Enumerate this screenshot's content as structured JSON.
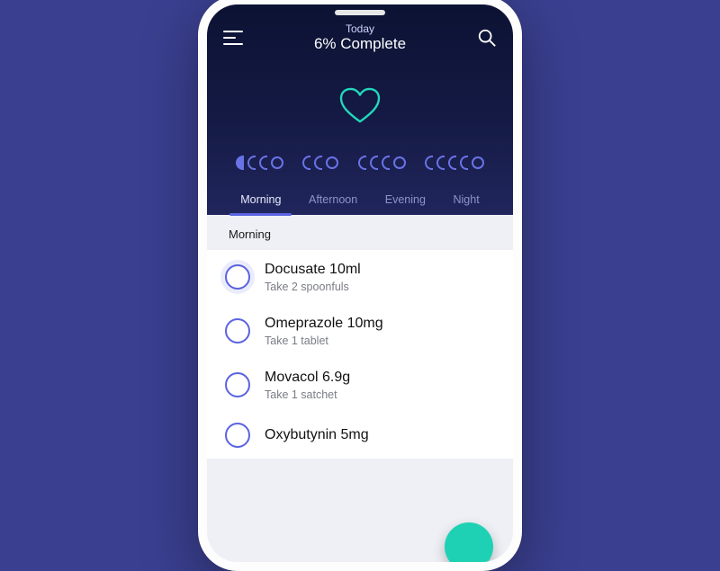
{
  "header": {
    "subtitle": "Today",
    "title": "6% Complete"
  },
  "progress": {
    "groups": [
      {
        "filled": 1,
        "pills": 3,
        "circles": 1
      },
      {
        "filled": 0,
        "pills": 2,
        "circles": 1
      },
      {
        "filled": 0,
        "pills": 3,
        "circles": 1
      },
      {
        "filled": 0,
        "pills": 4,
        "circles": 1
      }
    ]
  },
  "tabs": {
    "items": [
      "Morning",
      "Afternoon",
      "Evening",
      "Night"
    ],
    "active_index": 0
  },
  "section": {
    "label": "Morning"
  },
  "meds": [
    {
      "name": "Docusate 10ml",
      "sub": "Take 2 spoonfuls"
    },
    {
      "name": "Omeprazole 10mg",
      "sub": "Take 1 tablet"
    },
    {
      "name": "Movacol 6.9g",
      "sub": "Take 1 satchet"
    },
    {
      "name": "Oxybutynin 5mg",
      "sub": ""
    }
  ],
  "colors": {
    "accent": "#5a63e0",
    "fab": "#1fd1b4"
  }
}
